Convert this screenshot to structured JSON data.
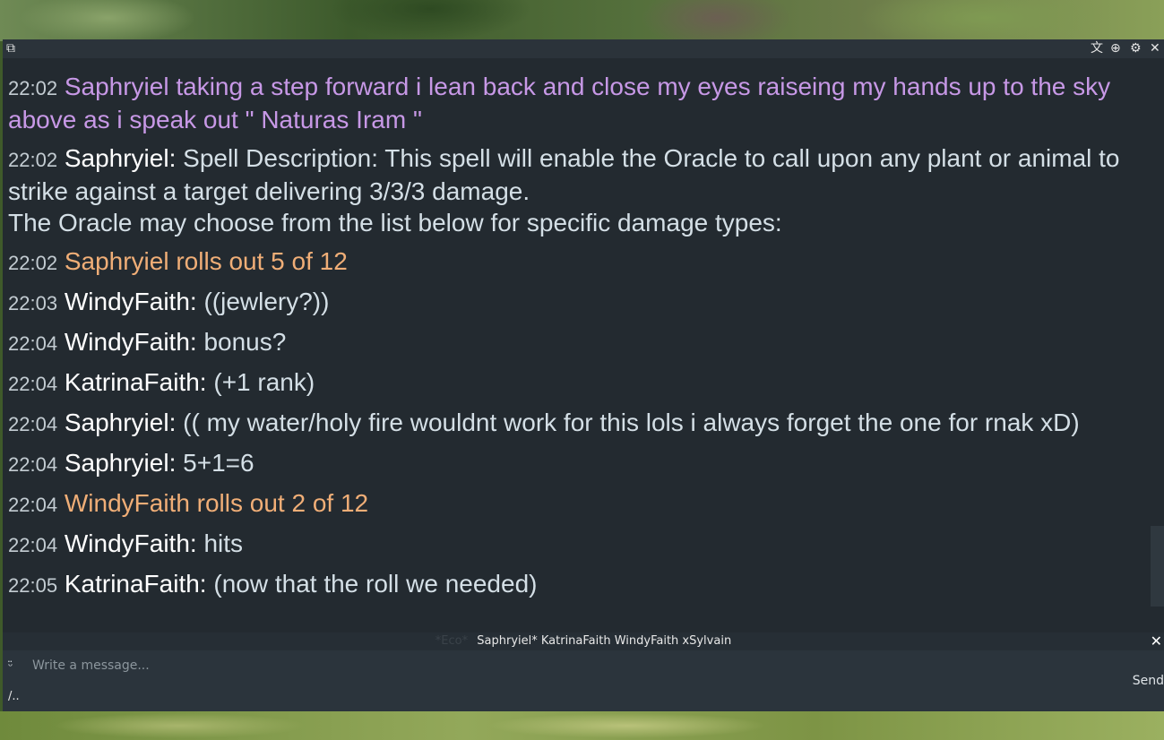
{
  "titlebar": {
    "left_icon": "window-icon",
    "translate_icon": "translate-icon",
    "add_icon": "add-chat-icon",
    "settings_icon": "gear-icon",
    "close_icon": "close-icon"
  },
  "messages": [
    {
      "time": "22:02",
      "type": "emote",
      "text": "Saphryiel taking a step forward i lean back and close my eyes raiseing my hands up to the sky above as i speak out \" Naturas Iram \""
    },
    {
      "time": "22:02",
      "type": "chat",
      "name": "Saphryiel:",
      "text": "Spell Description:   This spell will enable the Oracle to call upon any plant or animal to strike against a target delivering 3/3/3 damage.",
      "text2": "The Oracle may choose from the list below for specific damage types:"
    },
    {
      "time": "22:02",
      "type": "roll",
      "text": "Saphryiel rolls out 5 of 12"
    },
    {
      "time": "22:03",
      "type": "chat",
      "name": "WindyFaith:",
      "text": "((jewlery?))"
    },
    {
      "time": "22:04",
      "type": "chat",
      "name": "WindyFaith:",
      "text": "bonus?"
    },
    {
      "time": "22:04",
      "type": "chat",
      "name": "KatrinaFaith:",
      "text": "(+1 rank)"
    },
    {
      "time": "22:04",
      "type": "chat",
      "name": "Saphryiel:",
      "text": "(( my water/holy fire wouldnt work for this lols i always forget the one for rnak xD)"
    },
    {
      "time": "22:04",
      "type": "chat",
      "name": "Saphryiel:",
      "text": "5+1=6"
    },
    {
      "time": "22:04",
      "type": "roll",
      "text": "WindyFaith rolls out 2 of 12"
    },
    {
      "time": "22:04",
      "type": "chat",
      "name": "WindyFaith:",
      "text": "hits"
    },
    {
      "time": "22:05",
      "type": "chat",
      "name": "KatrinaFaith:",
      "text": "(now that the roll we needed)"
    }
  ],
  "participants": {
    "eco": "*Eco*",
    "names": "Saphryiel* KatrinaFaith WindyFaith xSylvain",
    "close_icon": "close-icon"
  },
  "input": {
    "placeholder": "Write a message...",
    "send_label": "Send",
    "command_hint": "/..",
    "emoji_icon": "emoji-icon"
  },
  "colors": {
    "panel_bg": "#232a30",
    "emote": "#c798e6",
    "roll": "#f0ae77",
    "name": "#ffffff",
    "text": "#d4dfe6"
  }
}
